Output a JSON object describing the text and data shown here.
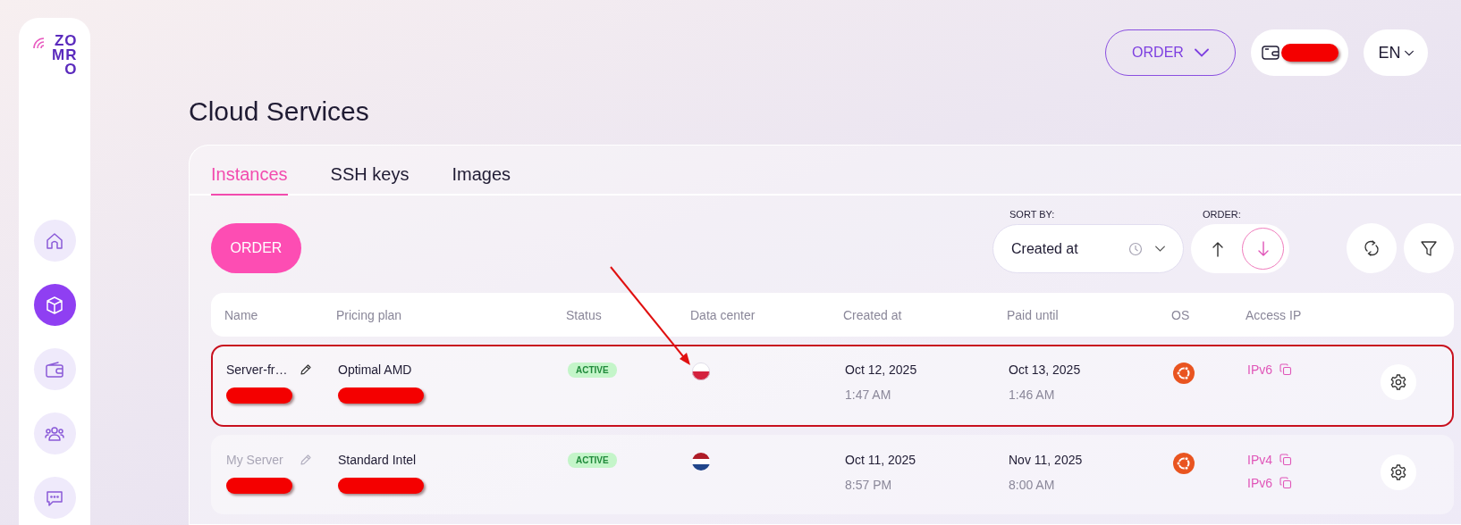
{
  "logo": {
    "text": "ZOMRO"
  },
  "sidebar": {
    "items": [
      {
        "kind": "home",
        "selected": false
      },
      {
        "kind": "box",
        "selected": true
      },
      {
        "kind": "wallet",
        "selected": false
      },
      {
        "kind": "users",
        "selected": false
      },
      {
        "kind": "chat",
        "selected": false
      }
    ]
  },
  "header": {
    "order_button": "ORDER",
    "wallet": {
      "balance_redacted": true
    },
    "language": "EN"
  },
  "page_title": "Cloud Services",
  "tabs": [
    {
      "label": "Instances",
      "selected": true
    },
    {
      "label": "SSH keys",
      "selected": false
    },
    {
      "label": "Images",
      "selected": false
    }
  ],
  "toolbar": {
    "order_button": "ORDER",
    "sort_by": {
      "label": "SORT BY:",
      "value": "Created at"
    },
    "order": {
      "label": "ORDER:",
      "options": [
        {
          "kind": "ascending",
          "selected": false
        },
        {
          "kind": "descending",
          "selected": true
        }
      ]
    }
  },
  "table": {
    "columns": [
      "Name",
      "Pricing plan",
      "Status",
      "Data center",
      "Created at",
      "Paid until",
      "OS",
      "Access IP"
    ],
    "rows": [
      {
        "name": "Server-fr…",
        "name_dimmed": false,
        "name_redacted": true,
        "plan": "Optimal AMD",
        "plan_redacted": true,
        "status": "ACTIVE",
        "datacenter": {
          "kind": "poland"
        },
        "created_date": "Oct 12, 2025",
        "created_time": "1:47 AM",
        "paid_date": "Oct 13, 2025",
        "paid_time": "1:46 AM",
        "os": {
          "kind": "ubuntu"
        },
        "access_ip": [
          "IPv6"
        ],
        "highlighted": true
      },
      {
        "name": "My Server",
        "name_dimmed": true,
        "name_redacted": true,
        "plan": "Standard Intel",
        "plan_redacted": true,
        "status": "ACTIVE",
        "datacenter": {
          "kind": "netherlands"
        },
        "created_date": "Oct 11, 2025",
        "created_time": "8:57 PM",
        "paid_date": "Nov 11, 2025",
        "paid_time": "8:00 AM",
        "os": {
          "kind": "ubuntu"
        },
        "access_ip": [
          "IPv4",
          "IPv6"
        ],
        "highlighted": false
      }
    ]
  },
  "annotation_arrow": true
}
